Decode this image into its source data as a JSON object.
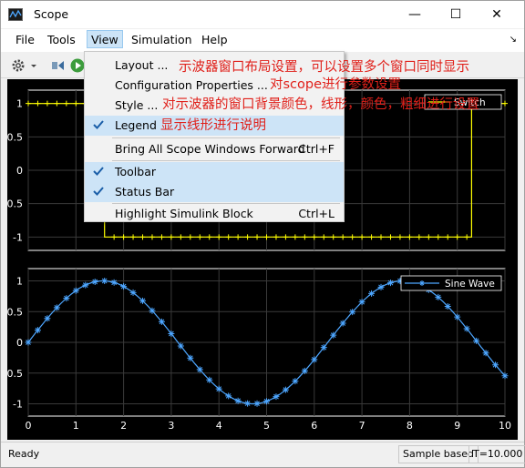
{
  "window": {
    "title": "Scope",
    "minimize": "—",
    "maximize": "☐",
    "close": "✕"
  },
  "menubar": {
    "file": "File",
    "tools": "Tools",
    "view": "View",
    "simulation": "Simulation",
    "help": "Help",
    "dock": "↘"
  },
  "view_menu": {
    "items": [
      {
        "label": "Layout ...",
        "shortcut": "",
        "checked": false
      },
      {
        "label": "Configuration Properties ...",
        "shortcut": "",
        "checked": false
      },
      {
        "label": "Style ...",
        "shortcut": "",
        "checked": false
      },
      {
        "label": "Legend",
        "shortcut": "",
        "checked": true
      },
      {
        "label": "Bring All Scope Windows Forward",
        "shortcut": "Ctrl+F",
        "checked": false
      },
      {
        "label": "Toolbar",
        "shortcut": "",
        "checked": true
      },
      {
        "label": "Status Bar",
        "shortcut": "",
        "checked": true
      },
      {
        "label": "Highlight Simulink Block",
        "shortcut": "Ctrl+L",
        "checked": false
      }
    ]
  },
  "annotations": {
    "layout": "示波器窗口布局设置，可以设置多个窗口同时显示",
    "config": "对scope进行参数设置",
    "style": "对示波器的窗口背景颜色，线形，颜色，粗细进行设置",
    "legend": "显示线形进行说明"
  },
  "status": {
    "left": "Ready",
    "mode": "Sample based",
    "time": "T=10.000"
  },
  "colors": {
    "plot_bg": "#000000",
    "axis": "#ffffff",
    "grid": "#3a3a3a",
    "series1": "#ffff00",
    "series2": "#4da6ff"
  },
  "top_axes": {
    "ytick_1": "1",
    "ytick_05": "0.5",
    "ytick_0": "0",
    "ytick_n05": "-0.5",
    "ytick_n1": "-1",
    "legend": "Switch"
  },
  "bottom_axes": {
    "yticks": [
      "1",
      "0.5",
      "0",
      "-0.5",
      "-1"
    ],
    "xticks": [
      "0",
      "1",
      "2",
      "3",
      "4",
      "5",
      "6",
      "7",
      "8",
      "9",
      "10"
    ],
    "legend": "Sine Wave"
  },
  "chart_data": [
    {
      "type": "line",
      "series": [
        {
          "name": "Switch",
          "x": [
            0,
            1.6,
            1.6,
            9.3,
            9.3,
            10
          ],
          "y": [
            1,
            1,
            -1,
            -1,
            1,
            1
          ]
        }
      ],
      "xlim": [
        0,
        10
      ],
      "ylim": [
        -1.2,
        1.2
      ],
      "grid": true,
      "legend": "top-right"
    },
    {
      "type": "line",
      "series": [
        {
          "name": "Sine Wave",
          "function": "sin(x)",
          "x_step": 0.2
        }
      ],
      "xlim": [
        0,
        10
      ],
      "ylim": [
        -1.2,
        1.2
      ],
      "grid": true,
      "legend": "top-right"
    }
  ]
}
